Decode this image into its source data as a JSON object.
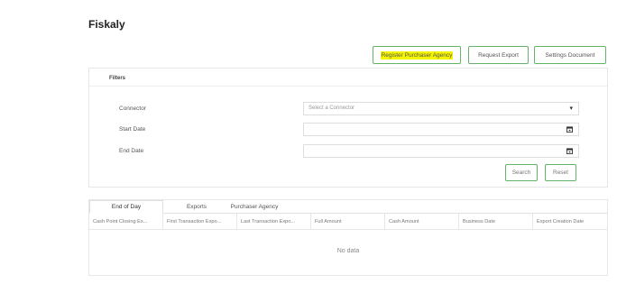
{
  "page": {
    "title": "Fiskaly"
  },
  "toolbar": {
    "register_label": "Register Purchaser Agency",
    "request_export_label": "Request Export",
    "settings_label": "Settings Document"
  },
  "filters": {
    "title": "Filters",
    "connector_label": "Connector",
    "connector_placeholder": "Select a Connector",
    "start_date_label": "Start Date",
    "end_date_label": "End Date",
    "search_label": "Search",
    "reset_label": "Reset"
  },
  "tabs": [
    {
      "label": "End of Day",
      "active": true
    },
    {
      "label": "Exports",
      "active": false
    },
    {
      "label": "Purchaser Agency",
      "active": false
    }
  ],
  "table": {
    "columns": [
      "Cash Point Closing Ex...",
      "First Transaction Expo...",
      "Last Transaction Expo...",
      "Full Amount",
      "Cash Amount",
      "Business Date",
      "Export Creation Date"
    ],
    "empty_text": "No data"
  },
  "colors": {
    "accent_border": "#63b36a",
    "highlight": "#f5f500"
  },
  "icons": {
    "dropdown": "chevron-down-icon",
    "date": "calendar-icon"
  }
}
